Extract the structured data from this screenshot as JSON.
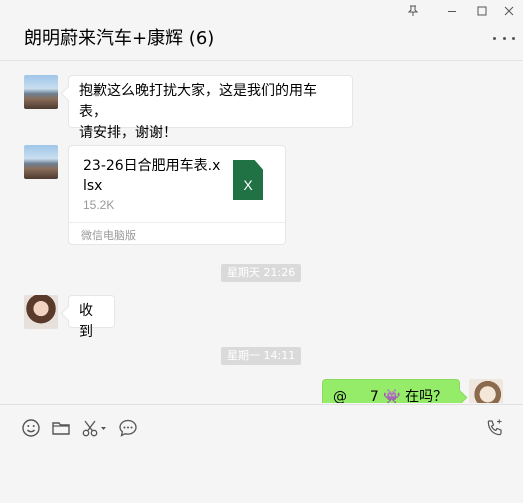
{
  "window": {
    "title": "朗明蔚来汽车+康辉 (6)",
    "pin_icon": "pin-icon",
    "minimize_icon": "minimize-icon",
    "maximize_icon": "maximize-icon",
    "close_icon": "close-icon",
    "more_icon": "more-icon"
  },
  "messages": [
    {
      "type": "text",
      "side": "left",
      "text_line1": "抱歉这么晚打扰大家，这是我们的用车表，",
      "text_line2": "请安排，谢谢！"
    },
    {
      "type": "file",
      "side": "left",
      "file_name": "23-26日合肥用车表.xlsx",
      "file_size": "15.2K",
      "file_icon_letter": "X",
      "source": "微信电脑版"
    },
    {
      "type": "timestamp",
      "text": "星期天 21:26"
    },
    {
      "type": "text",
      "side": "left",
      "text": "收到"
    },
    {
      "type": "timestamp",
      "text": "星期一 14:11"
    },
    {
      "type": "text",
      "side": "right",
      "text_prefix": "@",
      "text_name": "7",
      "text_emoji": "👾",
      "text_suffix": "在吗？"
    }
  ],
  "toolbar": {
    "emoji_icon": "emoji-icon",
    "folder_icon": "folder-icon",
    "scissors_icon": "scissors-icon",
    "chat_icon": "chat-history-icon",
    "call_icon": "voice-call-icon"
  },
  "colors": {
    "sent_bubble": "#95ec69",
    "excel_green": "#207245",
    "timestamp_bg": "#dadada"
  }
}
